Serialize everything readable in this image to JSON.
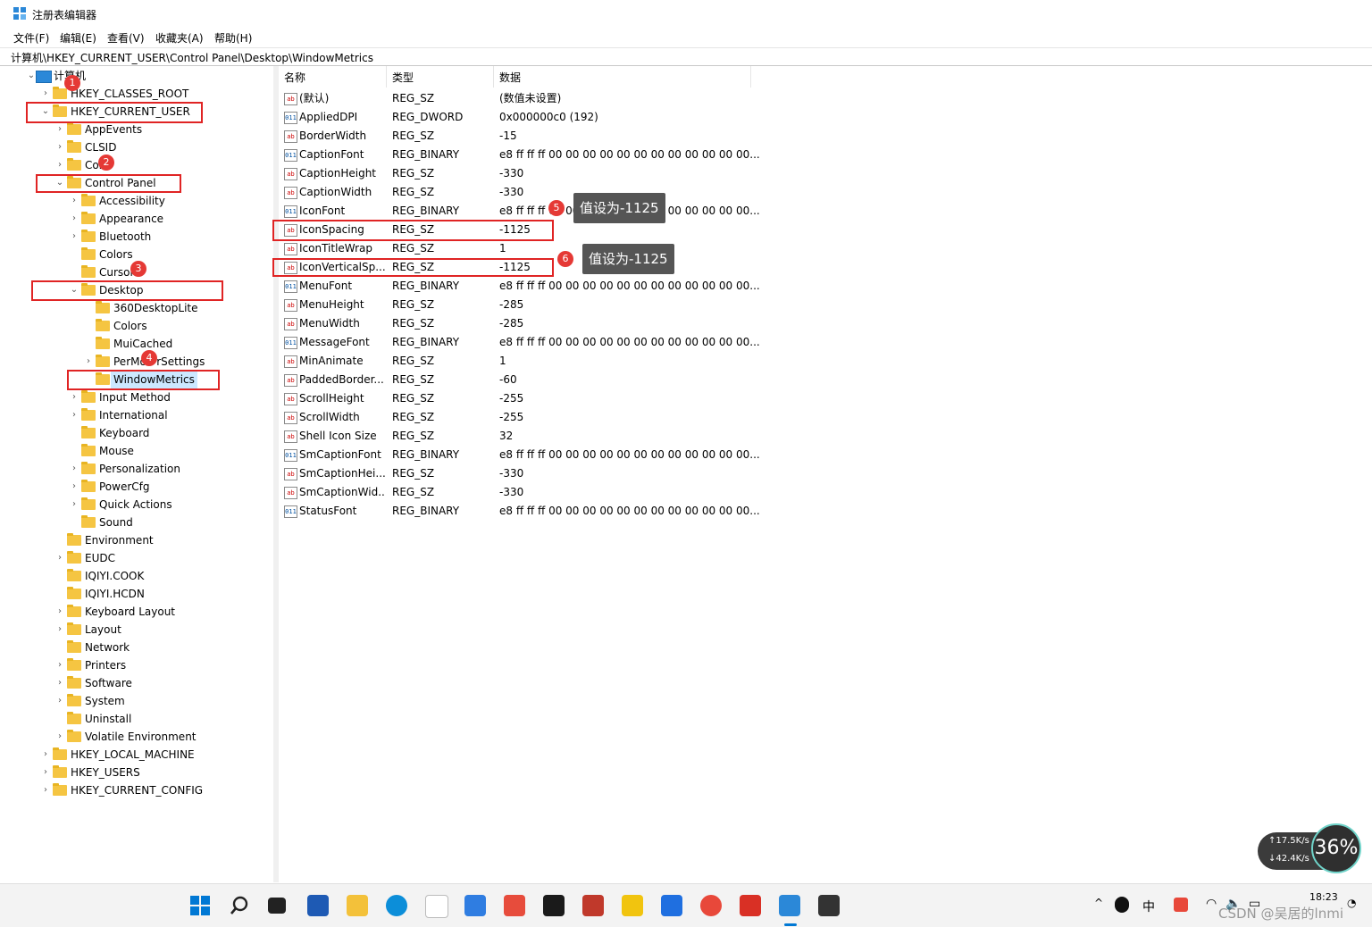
{
  "window": {
    "title": "注册表编辑器"
  },
  "menu": [
    "文件(F)",
    "编辑(E)",
    "查看(V)",
    "收藏夹(A)",
    "帮助(H)"
  ],
  "address": "计算机\\HKEY_CURRENT_USER\\Control Panel\\Desktop\\WindowMetrics",
  "tree": [
    {
      "label": "计算机",
      "level": 0,
      "exp": "open"
    },
    {
      "label": "HKEY_CLASSES_ROOT",
      "level": 1,
      "exp": "closed"
    },
    {
      "label": "HKEY_CURRENT_USER",
      "level": 1,
      "exp": "open"
    },
    {
      "label": "AppEvents",
      "level": 2,
      "exp": "closed"
    },
    {
      "label": "CLSID",
      "level": 2,
      "exp": "closed"
    },
    {
      "label": "Cons",
      "level": 2,
      "exp": "closed"
    },
    {
      "label": "Control Panel",
      "level": 2,
      "exp": "open"
    },
    {
      "label": "Accessibility",
      "level": 3,
      "exp": "closed"
    },
    {
      "label": "Appearance",
      "level": 3,
      "exp": "closed"
    },
    {
      "label": "Bluetooth",
      "level": 3,
      "exp": "closed"
    },
    {
      "label": "Colors",
      "level": 3,
      "exp": "none"
    },
    {
      "label": "Cursors",
      "level": 3,
      "exp": "none"
    },
    {
      "label": "Desktop",
      "level": 3,
      "exp": "open"
    },
    {
      "label": "360DesktopLite",
      "level": 4,
      "exp": "none"
    },
    {
      "label": "Colors",
      "level": 4,
      "exp": "none"
    },
    {
      "label": "MuiCached",
      "level": 4,
      "exp": "none"
    },
    {
      "label": "PerMon  rSettings",
      "level": 4,
      "exp": "closed"
    },
    {
      "label": "WindowMetrics",
      "level": 4,
      "exp": "none",
      "selected": true
    },
    {
      "label": "Input Method",
      "level": 3,
      "exp": "closed"
    },
    {
      "label": "International",
      "level": 3,
      "exp": "closed"
    },
    {
      "label": "Keyboard",
      "level": 3,
      "exp": "none"
    },
    {
      "label": "Mouse",
      "level": 3,
      "exp": "none"
    },
    {
      "label": "Personalization",
      "level": 3,
      "exp": "closed"
    },
    {
      "label": "PowerCfg",
      "level": 3,
      "exp": "closed"
    },
    {
      "label": "Quick Actions",
      "level": 3,
      "exp": "closed"
    },
    {
      "label": "Sound",
      "level": 3,
      "exp": "none"
    },
    {
      "label": "Environment",
      "level": 2,
      "exp": "none"
    },
    {
      "label": "EUDC",
      "level": 2,
      "exp": "closed"
    },
    {
      "label": "IQIYI.COOK",
      "level": 2,
      "exp": "none"
    },
    {
      "label": "IQIYI.HCDN",
      "level": 2,
      "exp": "none"
    },
    {
      "label": "Keyboard Layout",
      "level": 2,
      "exp": "closed"
    },
    {
      "label": "Layout",
      "level": 2,
      "exp": "closed"
    },
    {
      "label": "Network",
      "level": 2,
      "exp": "none"
    },
    {
      "label": "Printers",
      "level": 2,
      "exp": "closed"
    },
    {
      "label": "Software",
      "level": 2,
      "exp": "closed"
    },
    {
      "label": "System",
      "level": 2,
      "exp": "closed"
    },
    {
      "label": "Uninstall",
      "level": 2,
      "exp": "none"
    },
    {
      "label": "Volatile Environment",
      "level": 2,
      "exp": "closed"
    },
    {
      "label": "HKEY_LOCAL_MACHINE",
      "level": 1,
      "exp": "closed"
    },
    {
      "label": "HKEY_USERS",
      "level": 1,
      "exp": "closed"
    },
    {
      "label": "HKEY_CURRENT_CONFIG",
      "level": 1,
      "exp": "closed"
    }
  ],
  "columns": [
    "名称",
    "类型",
    "数据"
  ],
  "values": [
    {
      "name": "(默认)",
      "type": "REG_SZ",
      "data": "(数值未设置)",
      "kind": "sz"
    },
    {
      "name": "AppliedDPI",
      "type": "REG_DWORD",
      "data": "0x000000c0 (192)",
      "kind": "bin"
    },
    {
      "name": "BorderWidth",
      "type": "REG_SZ",
      "data": "-15",
      "kind": "sz"
    },
    {
      "name": "CaptionFont",
      "type": "REG_BINARY",
      "data": "e8 ff ff ff 00 00 00 00 00 00 00 00 00 00 00 00...",
      "kind": "bin"
    },
    {
      "name": "CaptionHeight",
      "type": "REG_SZ",
      "data": "-330",
      "kind": "sz"
    },
    {
      "name": "CaptionWidth",
      "type": "REG_SZ",
      "data": "-330",
      "kind": "sz"
    },
    {
      "name": "IconFont",
      "type": "REG_BINARY",
      "data": "e8 ff ff ff 00 00 00 00 00 00 00 00 00 00 00 00...",
      "kind": "bin"
    },
    {
      "name": "IconSpacing",
      "type": "REG_SZ",
      "data": "-1125",
      "kind": "sz"
    },
    {
      "name": "IconTitleWrap",
      "type": "REG_SZ",
      "data": "1",
      "kind": "sz"
    },
    {
      "name": "IconVerticalSp...",
      "type": "REG_SZ",
      "data": "-1125",
      "kind": "sz"
    },
    {
      "name": "MenuFont",
      "type": "REG_BINARY",
      "data": "e8 ff ff ff 00 00 00 00 00 00 00 00 00 00 00 00...",
      "kind": "bin"
    },
    {
      "name": "MenuHeight",
      "type": "REG_SZ",
      "data": "-285",
      "kind": "sz"
    },
    {
      "name": "MenuWidth",
      "type": "REG_SZ",
      "data": "-285",
      "kind": "sz"
    },
    {
      "name": "MessageFont",
      "type": "REG_BINARY",
      "data": "e8 ff ff ff 00 00 00 00 00 00 00 00 00 00 00 00...",
      "kind": "bin"
    },
    {
      "name": "MinAnimate",
      "type": "REG_SZ",
      "data": "1",
      "kind": "sz"
    },
    {
      "name": "PaddedBorder...",
      "type": "REG_SZ",
      "data": "-60",
      "kind": "sz"
    },
    {
      "name": "ScrollHeight",
      "type": "REG_SZ",
      "data": "-255",
      "kind": "sz"
    },
    {
      "name": "ScrollWidth",
      "type": "REG_SZ",
      "data": "-255",
      "kind": "sz"
    },
    {
      "name": "Shell Icon Size",
      "type": "REG_SZ",
      "data": "32",
      "kind": "sz"
    },
    {
      "name": "SmCaptionFont",
      "type": "REG_BINARY",
      "data": "e8 ff ff ff 00 00 00 00 00 00 00 00 00 00 00 00...",
      "kind": "bin"
    },
    {
      "name": "SmCaptionHei...",
      "type": "REG_SZ",
      "data": "-330",
      "kind": "sz"
    },
    {
      "name": "SmCaptionWid...",
      "type": "REG_SZ",
      "data": "-330",
      "kind": "sz"
    },
    {
      "name": "StatusFont",
      "type": "REG_BINARY",
      "data": "e8 ff ff ff 00 00 00 00 00 00 00 00 00 00 00 00...",
      "kind": "bin"
    }
  ],
  "annotations": {
    "badges": [
      "1",
      "2",
      "3",
      "4",
      "5",
      "6"
    ],
    "tooltip5": "值设为-1125",
    "tooltip6": "值设为-1125"
  },
  "network_widget": {
    "up": "↑17.5K/s",
    "down": "↓42.4K/s",
    "percent": "36%"
  },
  "tray": {
    "ime": "中",
    "time": "18:23",
    "watermark": "CSDN @吴居的lnmi"
  },
  "colors": {
    "highlight": "#e02424",
    "selection": "#cce8ff",
    "folder": "#f5c542"
  }
}
